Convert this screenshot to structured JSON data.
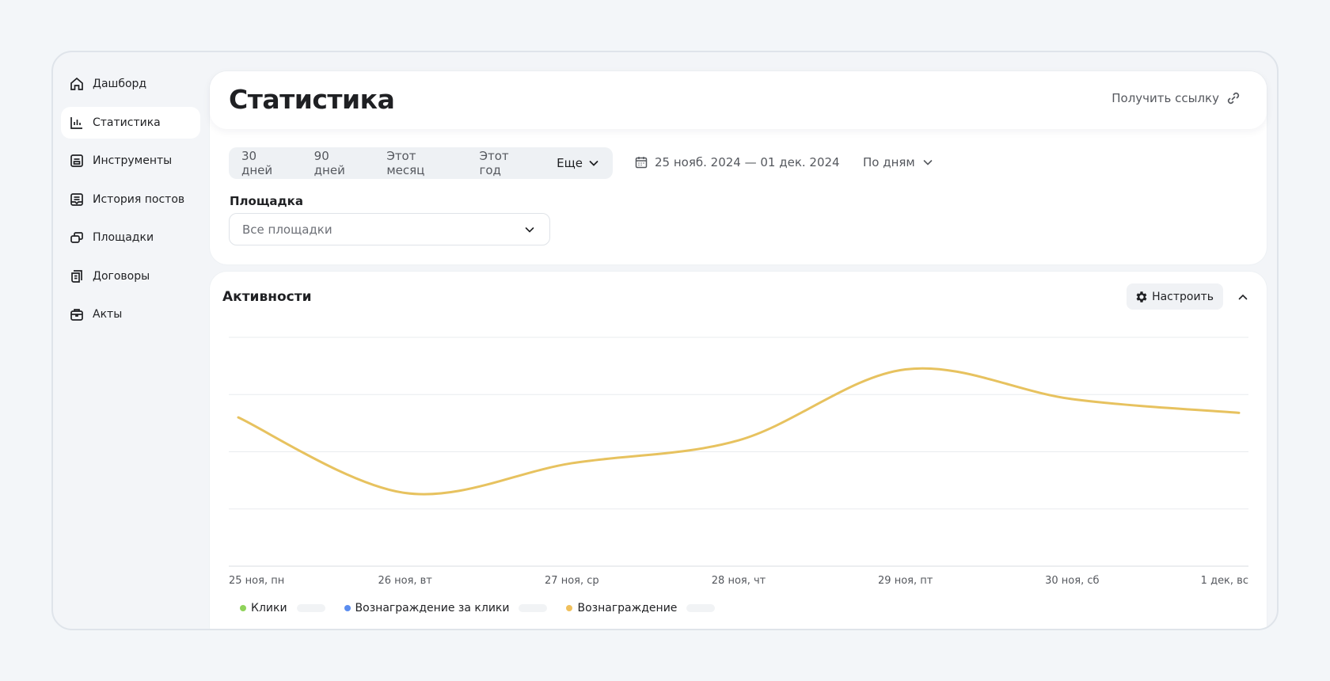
{
  "sidebar": {
    "items": [
      {
        "label": "Дашборд",
        "icon": "home-icon",
        "active": false
      },
      {
        "label": "Статистика",
        "icon": "bar-chart-icon",
        "active": true
      },
      {
        "label": "Инструменты",
        "icon": "tools-icon",
        "active": false
      },
      {
        "label": "История постов",
        "icon": "posts-history-icon",
        "active": false
      },
      {
        "label": "Площадки",
        "icon": "platforms-icon",
        "active": false
      },
      {
        "label": "Договоры",
        "icon": "contract-icon",
        "active": false
      },
      {
        "label": "Акты",
        "icon": "acts-icon",
        "active": false
      }
    ]
  },
  "header": {
    "title": "Статистика",
    "get_link_label": "Получить ссылку"
  },
  "filters": {
    "periods": [
      "30 дней",
      "90 дней",
      "Этот месяц",
      "Этот год"
    ],
    "more_label": "Еще",
    "date_range": "25 нояб. 2024 — 01 дек. 2024",
    "grouping": "По дням",
    "platform_label": "Площадка",
    "platform_value": "Все площадки"
  },
  "activity": {
    "title": "Активности",
    "configure_label": "Настроить"
  },
  "colors": {
    "line": "#e7c25f",
    "legend_clicks": "#8fd35a",
    "legend_click_reward": "#5b8def",
    "legend_reward": "#f0c05c"
  },
  "chart_data": {
    "type": "line",
    "x": [
      "25 ноя, пн",
      "26 ноя, вт",
      "27 ноя, ср",
      "28 ноя, чт",
      "29 ноя, пт",
      "30 ноя, сб",
      "1 дек, вс"
    ],
    "series": [
      {
        "name": "Вознаграждение",
        "values": [
          0.65,
          0.32,
          0.45,
          0.55,
          0.86,
          0.73,
          0.67
        ]
      }
    ],
    "legend": [
      "Клики",
      "Вознаграждение за клики",
      "Вознаграждение"
    ],
    "ylim": [
      0,
      1
    ],
    "grid": true,
    "legend_position": "bottom-left"
  }
}
